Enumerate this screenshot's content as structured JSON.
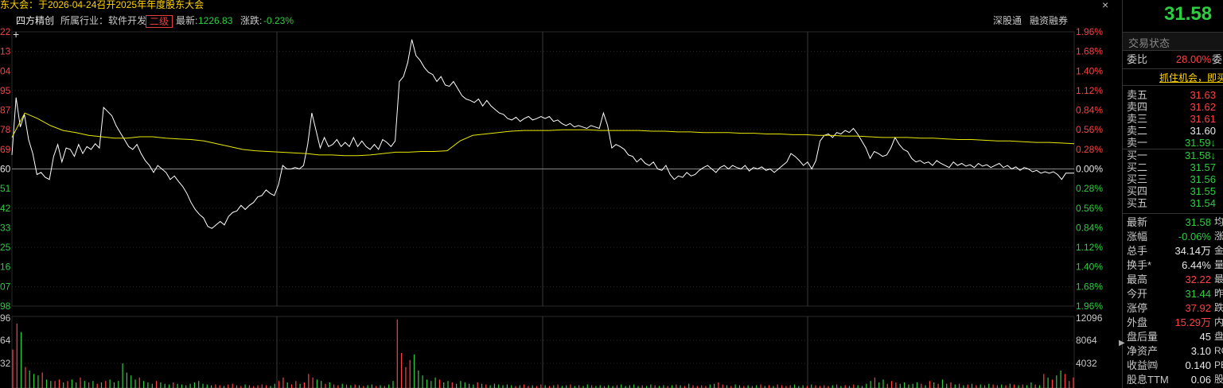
{
  "banner": {
    "text": "东大会：于2026-04-24召开2025年年度股东大会"
  },
  "header": {
    "stock_name": "四方精创",
    "industry": "所属行业：软件开发",
    "level": "二级",
    "index_label": "最新:",
    "index_value": "1226.83",
    "change_label": "涨跌:",
    "change_value": "-0.23%",
    "link_sgt": "深股通",
    "link_margin": "融资融券",
    "close": "×",
    "cross": "+"
  },
  "chart_data": {
    "type": "line",
    "price_axis_ticks": [
      "22",
      "13",
      "04",
      "95",
      "87",
      "78",
      "69",
      "60",
      "51",
      "42",
      "33",
      "25",
      "16",
      "07",
      "98"
    ],
    "percent_ticks": [
      "1.96%",
      "1.68%",
      "1.40%",
      "1.12%",
      "0.84%",
      "0.56%",
      "0.28%",
      "0.00%",
      "0.28%",
      "0.56%",
      "0.84%",
      "1.12%",
      "1.40%",
      "1.68%",
      "1.96%"
    ],
    "ylim_percent": [
      -1.96,
      1.96
    ],
    "volume_left_ticks": [
      "96",
      "64",
      "32"
    ],
    "volume_right_ticks": [
      "12096",
      "8064",
      "4032"
    ],
    "volume_max": 12096,
    "price_series": [
      0.2,
      1.02,
      0.6,
      0.78,
      0.42,
      0.22,
      -0.08,
      -0.05,
      -0.12,
      -0.15,
      0.18,
      0.35,
      0.1,
      0.3,
      0.28,
      0.18,
      0.35,
      0.22,
      0.32,
      0.28,
      0.36,
      0.3,
      0.88,
      0.82,
      0.76,
      0.62,
      0.52,
      0.42,
      0.32,
      0.28,
      0.35,
      0.22,
      0.12,
      0.05,
      -0.05,
      0.05,
      0.0,
      -0.05,
      -0.15,
      -0.1,
      -0.18,
      -0.25,
      -0.35,
      -0.48,
      -0.58,
      -0.65,
      -0.7,
      -0.82,
      -0.85,
      -0.8,
      -0.75,
      -0.8,
      -0.68,
      -0.62,
      -0.6,
      -0.52,
      -0.58,
      -0.52,
      -0.48,
      -0.4,
      -0.38,
      -0.3,
      -0.35,
      -0.38,
      -0.22,
      0.05,
      0.0,
      0.0,
      0.02,
      0.0,
      0.05,
      0.35,
      0.8,
      0.55,
      0.3,
      0.45,
      0.32,
      0.35,
      0.42,
      0.32,
      0.38,
      0.32,
      0.45,
      0.32,
      0.4,
      0.32,
      0.28,
      0.35,
      0.28,
      0.42,
      0.38,
      0.32,
      0.4,
      1.25,
      1.32,
      1.52,
      1.85,
      1.62,
      1.55,
      1.45,
      1.38,
      1.35,
      1.25,
      1.32,
      1.2,
      1.18,
      1.25,
      1.15,
      1.05,
      1.0,
      0.98,
      0.95,
      1.0,
      0.9,
      0.98,
      0.9,
      0.85,
      0.8,
      0.78,
      0.72,
      0.7,
      0.74,
      0.68,
      0.72,
      0.75,
      0.7,
      0.72,
      0.75,
      0.72,
      0.75,
      0.68,
      0.7,
      0.65,
      0.62,
      0.65,
      0.6,
      0.62,
      0.6,
      0.58,
      0.62,
      0.6,
      0.58,
      0.8,
      0.62,
      0.3,
      0.35,
      0.32,
      0.28,
      0.2,
      0.18,
      0.1,
      0.15,
      0.08,
      0.05,
      0.1,
      0.0,
      -0.02,
      0.05,
      -0.08,
      -0.15,
      -0.1,
      -0.12,
      -0.05,
      -0.1,
      -0.08,
      -0.02,
      0.02,
      0.05,
      0.0,
      -0.05,
      0.02,
      0.05,
      0.0,
      0.05,
      0.02,
      0.0,
      0.05,
      -0.03,
      0.02,
      0.0,
      0.03,
      -0.02,
      0.0,
      -0.05,
      0.0,
      0.05,
      0.1,
      0.22,
      0.18,
      0.12,
      0.05,
      0.1,
      0.0,
      0.12,
      0.4,
      0.48,
      0.5,
      0.45,
      0.52,
      0.5,
      0.55,
      0.52,
      0.58,
      0.5,
      0.4,
      0.3,
      0.15,
      0.25,
      0.22,
      0.18,
      0.2,
      0.3,
      0.45,
      0.35,
      0.28,
      0.25,
      0.15,
      0.1,
      0.12,
      0.08,
      0.1,
      0.05,
      0.12,
      0.08,
      0.05,
      0.02,
      0.1,
      0.05,
      0.08,
      0.04,
      0.06,
      0.02,
      0.08,
      0.04,
      0.06,
      0.02,
      0.05,
      0.08,
      0.02,
      0.05,
      0.0,
      0.03,
      -0.02,
      0.02,
      0.0,
      -0.04,
      -0.02,
      -0.06,
      -0.04,
      -0.06,
      -0.04,
      -0.08,
      -0.15,
      -0.06,
      -0.06,
      -0.06
    ],
    "avg_series": [
      0.45,
      0.8,
      0.72,
      0.62,
      0.55,
      0.52,
      0.48,
      0.46,
      0.44,
      0.44,
      0.46,
      0.46,
      0.44,
      0.43,
      0.42,
      0.4,
      0.36,
      0.32,
      0.28,
      0.26,
      0.25,
      0.24,
      0.23,
      0.22,
      0.2,
      0.2,
      0.19,
      0.19,
      0.2,
      0.22,
      0.24,
      0.24,
      0.25,
      0.25,
      0.26,
      0.4,
      0.48,
      0.5,
      0.52,
      0.54,
      0.55,
      0.55,
      0.55,
      0.56,
      0.56,
      0.56,
      0.55,
      0.55,
      0.55,
      0.55,
      0.54,
      0.54,
      0.53,
      0.53,
      0.52,
      0.52,
      0.52,
      0.51,
      0.51,
      0.5,
      0.5,
      0.49,
      0.49,
      0.48,
      0.48,
      0.47,
      0.47,
      0.46,
      0.45,
      0.45,
      0.45,
      0.44,
      0.44,
      0.43,
      0.42,
      0.42,
      0.41,
      0.4,
      0.4,
      0.39,
      0.38,
      0.38,
      0.37,
      0.36
    ],
    "volume_series": [
      0.55,
      0.92,
      0.8,
      0.3,
      0.25,
      0.2,
      0.18,
      0.22,
      0.12,
      0.1,
      0.1,
      0.12,
      0.08,
      0.1,
      0.12,
      0.08,
      0.15,
      0.1,
      0.08,
      0.1,
      0.06,
      0.08,
      0.1,
      0.12,
      0.08,
      0.1,
      0.35,
      0.22,
      0.18,
      0.12,
      0.15,
      0.1,
      0.08,
      0.06,
      0.1,
      0.08,
      0.06,
      0.05,
      0.08,
      0.06,
      0.05,
      0.04,
      0.06,
      0.08,
      0.1,
      0.06,
      0.05,
      0.04,
      0.05,
      0.04,
      0.03,
      0.05,
      0.06,
      0.04,
      0.03,
      0.05,
      0.04,
      0.03,
      0.04,
      0.05,
      0.04,
      0.03,
      0.06,
      0.1,
      0.15,
      0.08,
      0.05,
      0.1,
      0.06,
      0.08,
      0.2,
      0.15,
      0.12,
      0.1,
      0.06,
      0.08,
      0.05,
      0.04,
      0.06,
      0.05,
      0.04,
      0.05,
      0.04,
      0.03,
      0.04,
      0.05,
      0.03,
      0.04,
      0.03,
      0.05,
      0.1,
      0.98,
      0.5,
      0.3,
      0.4,
      0.48,
      0.25,
      0.18,
      0.12,
      0.1,
      0.15,
      0.12,
      0.08,
      0.1,
      0.08,
      0.06,
      0.1,
      0.08,
      0.06,
      0.05,
      0.08,
      0.06,
      0.05,
      0.04,
      0.06,
      0.05,
      0.04,
      0.05,
      0.04,
      0.03,
      0.04,
      0.05,
      0.03,
      0.04,
      0.03,
      0.05,
      0.04,
      0.03,
      0.04,
      0.05,
      0.03,
      0.04,
      0.05,
      0.03,
      0.04,
      0.03,
      0.05,
      0.04,
      0.03,
      0.04,
      0.03,
      0.04,
      0.03,
      0.04,
      0.05,
      0.03,
      0.04,
      0.05,
      0.03,
      0.04,
      0.03,
      0.05,
      0.04,
      0.03,
      0.04,
      0.03,
      0.04,
      0.05,
      0.04,
      0.03,
      0.06,
      0.04,
      0.03,
      0.04,
      0.03,
      0.05,
      0.06,
      0.08,
      0.05,
      0.04,
      0.03,
      0.05,
      0.04,
      0.03,
      0.04,
      0.03,
      0.04,
      0.05,
      0.03,
      0.04,
      0.03,
      0.05,
      0.04,
      0.03,
      0.04,
      0.05,
      0.03,
      0.04,
      0.03,
      0.05,
      0.04,
      0.03,
      0.04,
      0.03,
      0.04,
      0.05,
      0.03,
      0.04,
      0.03,
      0.05,
      0.04,
      0.03,
      0.06,
      0.1,
      0.15,
      0.08,
      0.12,
      0.06,
      0.1,
      0.08,
      0.06,
      0.08,
      0.05,
      0.06,
      0.08,
      0.06,
      0.04,
      0.1,
      0.08,
      0.06,
      0.12,
      0.06,
      0.08,
      0.05,
      0.06,
      0.04,
      0.05,
      0.06,
      0.04,
      0.05,
      0.04,
      0.06,
      0.05,
      0.04,
      0.05,
      0.04,
      0.06,
      0.05,
      0.04,
      0.05,
      0.04,
      0.08,
      0.05,
      0.04,
      0.2,
      0.15,
      0.12,
      0.18,
      0.25,
      0.2,
      0.1,
      0.15
    ],
    "volume_colors_rule": "red when price up vs previous, green otherwise"
  },
  "panel": {
    "price": "31.58",
    "trade_status": "交易状态",
    "weibi_label": "委比",
    "weibi_value": "28.00%",
    "weibi_cut": "委",
    "promo": "抓住机会，即买",
    "sells": [
      {
        "label": "卖五",
        "price": "31.63",
        "color": "#ff4040"
      },
      {
        "label": "卖四",
        "price": "31.62",
        "color": "#ff4040"
      },
      {
        "label": "卖三",
        "price": "31.61",
        "color": "#ff4040"
      },
      {
        "label": "卖二",
        "price": "31.60",
        "color": "#e8e8e8"
      },
      {
        "label": "卖一",
        "price": "31.59↓",
        "color": "#2ecc40"
      }
    ],
    "buys": [
      {
        "label": "买一",
        "price": "31.58↓",
        "color": "#2ecc40"
      },
      {
        "label": "买二",
        "price": "31.57",
        "color": "#2ecc40"
      },
      {
        "label": "买三",
        "price": "31.56",
        "color": "#2ecc40"
      },
      {
        "label": "买四",
        "price": "31.55",
        "color": "#2ecc40"
      },
      {
        "label": "买五",
        "price": "31.54",
        "color": "#2ecc40"
      }
    ],
    "stats": [
      {
        "label": "最新",
        "value": "31.58",
        "color": "#2ecc40",
        "cut": "均"
      },
      {
        "label": "涨幅",
        "value": "-0.06%",
        "color": "#2ecc40",
        "cut": "涨"
      },
      {
        "label": "总手",
        "value": "34.14万",
        "color": "#e8e8e8",
        "cut": "金"
      },
      {
        "label": "换手*",
        "value": "6.44%",
        "color": "#e8e8e8",
        "cut": "量"
      },
      {
        "label": "最高",
        "value": "32.22",
        "color": "#ff4040",
        "cut": "最"
      },
      {
        "label": "今开",
        "value": "31.44",
        "color": "#2ecc40",
        "cut": "昨"
      },
      {
        "label": "涨停",
        "value": "37.92",
        "color": "#ff4040",
        "cut": "跌"
      },
      {
        "label": "外盘",
        "value": "15.29万",
        "color": "#ff4040",
        "cut": "内"
      },
      {
        "label": "盘后量",
        "value": "45",
        "color": "#e8e8e8",
        "cut": "盘"
      },
      {
        "label": "净资产",
        "value": "3.10",
        "color": "#e8e8e8",
        "cut": "RO"
      },
      {
        "label": "收益㈣",
        "value": "0.140",
        "color": "#e8e8e8",
        "cut": "PE"
      },
      {
        "label": "股息TTM",
        "value": "0.06",
        "color": "#e8e8e8",
        "cut": "股"
      }
    ]
  },
  "colors": {
    "up": "#ff4040",
    "down": "#2ecc40",
    "avg_line": "#e8e800",
    "price_line": "#ffffff",
    "grid": "#3a3a3a",
    "flat": "#e8e8e8"
  }
}
